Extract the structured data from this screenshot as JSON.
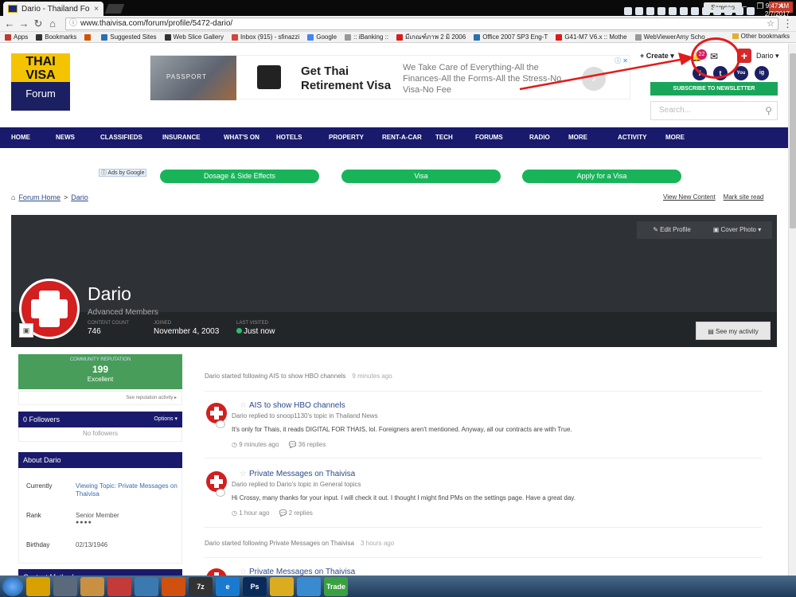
{
  "browser": {
    "tab_title": "Dario - Thailand Forum",
    "tab_close": "×",
    "profile_button": "Sampao",
    "url": "www.thaivisa.com/forum/profile/5472-dario/",
    "bookmarks": [
      {
        "label": "Apps",
        "color": "#c0392b"
      },
      {
        "label": "Bookmarks",
        "color": "#333333"
      },
      {
        "label": "",
        "color": "#d35400"
      },
      {
        "label": "Suggested Sites",
        "color": "#2c6fb0"
      },
      {
        "label": "Web Slice Gallery",
        "color": "#333333"
      },
      {
        "label": "Inbox (915) - sfinazzi",
        "color": "#d44638"
      },
      {
        "label": "Google",
        "color": "#4285f4"
      },
      {
        "label": ":: iBanking ::",
        "color": "#999999"
      },
      {
        "label": "มีเกณฑ์ภาพ 2 มิ 2006",
        "color": "#d91a1a"
      },
      {
        "label": "Office 2007 SP3 Eng-T",
        "color": "#2c6fb0"
      },
      {
        "label": "G41-M7 V6.x :: Mothe",
        "color": "#d91a1a"
      },
      {
        "label": "WebViewerAmy Scho",
        "color": "#999999"
      }
    ],
    "other_bookmarks": "Other bookmarks"
  },
  "site": {
    "logo_line1": "THAI",
    "logo_line2": "VISA",
    "logo_line3": "Forum"
  },
  "ad": {
    "photo_text": "PASSPORT",
    "headline": "Get Thai Retirement Visa",
    "subtext": "We Take Care of Everything-All the Finances-All the Forms-All the Stress-No Visa-No Fee",
    "arrow": "›",
    "ad_marker": "ⓘ ✕"
  },
  "userbar": {
    "create_label": "+ Create ▾",
    "notification_count": "22",
    "user_name": "Dario ▾",
    "newsletter_label": "SUBSCRIBE TO NEWSLETTER",
    "search_placeholder": "Search...",
    "social": [
      "f",
      "t",
      "You",
      "ig"
    ]
  },
  "mainnav": [
    "HOME",
    "NEWS",
    "CLASSIFIEDS",
    "INSURANCE",
    "WHAT'S ON",
    "HOTELS",
    "PROPERTY",
    "RENT-A-CAR",
    "TECH",
    "FORUMS",
    "RADIO",
    "MORE",
    "ACTIVITY",
    "MORE"
  ],
  "ads_by_google": "ⓘ Ads by Google",
  "google_pills": [
    "Dosage & Side Effects",
    "Visa",
    "Apply for a Visa"
  ],
  "breadcrumb": {
    "home": "Forum Home",
    "sep": ">",
    "current": "Dario",
    "view_new": "View New Content",
    "mark_read": "Mark site read"
  },
  "profile": {
    "name": "Dario",
    "group": "Advanced Members",
    "edit_profile": "Edit Profile",
    "cover_photo": "Cover Photo ▾",
    "content_count_label": "CONTENT COUNT",
    "content_count": "746",
    "joined_label": "JOINED",
    "joined": "November 4, 2003",
    "last_visited_label": "LAST VISITED",
    "last_visited": "Just now",
    "see_activity": "See my activity"
  },
  "sidebar": {
    "rep_label": "COMMUNITY REPUTATION",
    "rep_value": "199",
    "rep_level": "Excellent",
    "rep_link": "See reputation activity ▸",
    "followers_title": "0 Followers",
    "followers_options": "Options ▾",
    "no_followers": "No followers",
    "about_title": "About Dario",
    "about": {
      "currently_label": "Currently",
      "currently_value": "Viewing Topic: Private Messages on Thaivisa",
      "rank_label": "Rank",
      "rank_value": "Senior Member",
      "rank_dots": "●●●●",
      "birthday_label": "Birthday",
      "birthday_value": "02/13/1946"
    },
    "contact_title": "Contact Methods"
  },
  "feed": {
    "item1": {
      "text": "Dario started following AIS to show HBO channels",
      "time": "9 minutes ago"
    },
    "post1": {
      "star": "☆",
      "title": "AIS to show HBO channels",
      "meta": "Dario replied to snoop1130's topic in Thailand News",
      "body": "It's only for Thais, it reads DIGITAL FOR THAIS, lol. Foreigners aren't mentioned. Anyway, all our contracts are with True.",
      "time": "9 minutes ago",
      "replies": "36 replies"
    },
    "post2": {
      "star": "☆",
      "title": "Private Messages on Thaivisa",
      "meta": "Dario replied to Dario's topic in General topics",
      "body": "Hi Crossy, many thanks for your input. I will check it out. I thought I might find PMs on the settings page. Have a great day.",
      "time": "1 hour ago",
      "replies": "2 replies"
    },
    "item2": {
      "text": "Dario started following Private Messages on Thaivisa",
      "time": "3 hours ago"
    },
    "post3": {
      "star": "☆",
      "title": "Private Messages on Thaivisa"
    }
  },
  "taskbar": {
    "apps": [
      {
        "label": "",
        "color": "#d8a000"
      },
      {
        "label": "",
        "color": "#5a6a7a"
      },
      {
        "label": "",
        "color": "#c89040"
      },
      {
        "label": "",
        "color": "#c23a3a"
      },
      {
        "label": "",
        "color": "#3a7ab0"
      },
      {
        "label": "",
        "color": "#d05010"
      },
      {
        "label": "7z",
        "color": "#333333"
      },
      {
        "label": "e",
        "color": "#1a7ad0"
      },
      {
        "label": "Ps",
        "color": "#0a2a5a"
      },
      {
        "label": "",
        "color": "#dcac20"
      },
      {
        "label": "",
        "color": "#3a8ad0"
      },
      {
        "label": "Trade",
        "color": "#3aa040"
      }
    ],
    "time": "9:47 AM",
    "date": "2/7/2017"
  },
  "colors": {
    "nav_blue": "#191a6c",
    "green": "#19b45a",
    "annotation_red": "#e31b1b"
  }
}
